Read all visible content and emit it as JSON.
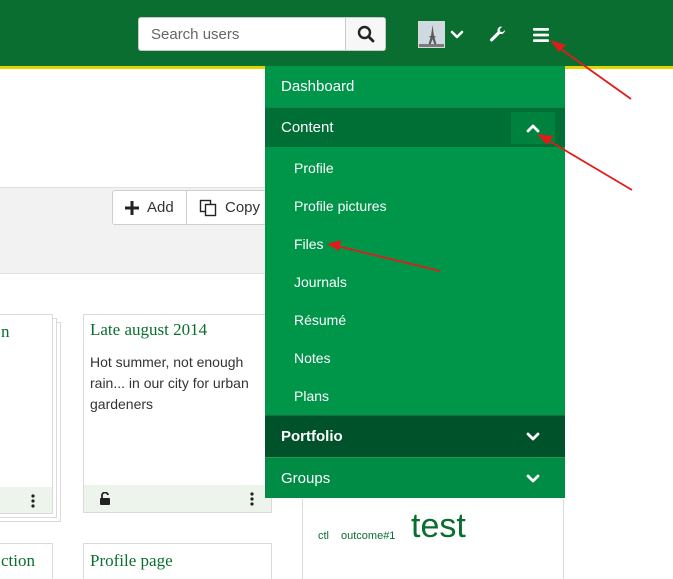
{
  "header": {
    "search": {
      "placeholder": "Search users"
    },
    "icons": {
      "search": "search-icon",
      "user_menu": "chevron-down-icon",
      "admin": "wrench-icon",
      "main_menu": "hamburger-menu-icon"
    },
    "colors": {
      "bar": "#0b6e31",
      "accent_line": "#e3d600"
    }
  },
  "toolbar": {
    "add_label": "Add",
    "copy_label": "Copy"
  },
  "cards": {
    "left_partial_title": "n",
    "main": {
      "title": "Late august 2014",
      "description": "Hot summer, not enough rain... in our city for urban gardeners"
    },
    "bottom_left_partial_title": "ction",
    "bottom_main_title": "Profile page"
  },
  "tags": {
    "t1": "ctl",
    "t2": "outcome#1",
    "t3": "test"
  },
  "menu": {
    "colors": {
      "background": "#00964a",
      "active": "#006f35",
      "hover": "#00522a"
    },
    "dashboard": "Dashboard",
    "content": "Content",
    "content_items": [
      "Profile",
      "Profile pictures",
      "Files",
      "Journals",
      "Résumé",
      "Notes",
      "Plans"
    ],
    "portfolio": "Portfolio",
    "groups": "Groups"
  }
}
